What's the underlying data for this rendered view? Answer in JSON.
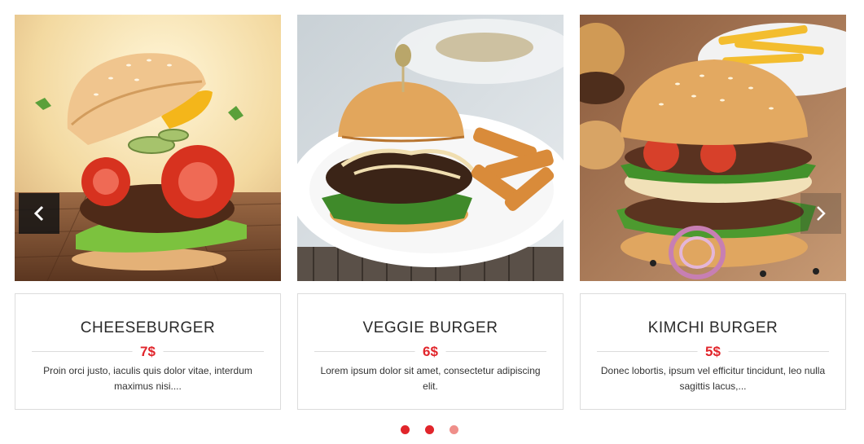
{
  "items": [
    {
      "title": "CHEESEBURGER",
      "price": "7$",
      "description": "Proin orci justo, iaculis quis dolor vitae, interdum maximus nisi....",
      "image_icon": "cheeseburger-photo"
    },
    {
      "title": "VEGGIE BURGER",
      "price": "6$",
      "description": "Lorem ipsum dolor sit amet, consectetur adipiscing elit.",
      "image_icon": "veggie-burger-photo"
    },
    {
      "title": "KIMCHI BURGER",
      "price": "5$",
      "description": "Donec lobortis, ipsum vel efficitur tincidunt, leo nulla sagittis lacus,...",
      "image_icon": "kimchi-burger-photo"
    }
  ],
  "navigation": {
    "prev_icon": "chevron-left-icon",
    "next_icon": "chevron-right-icon"
  },
  "pagination": {
    "dot_count": 3,
    "active_index": 2
  },
  "colors": {
    "accent": "#e1252b",
    "dot_inactive": "#ef8f8a",
    "border": "#dcdcdc",
    "title_text": "#2a2a2a"
  }
}
